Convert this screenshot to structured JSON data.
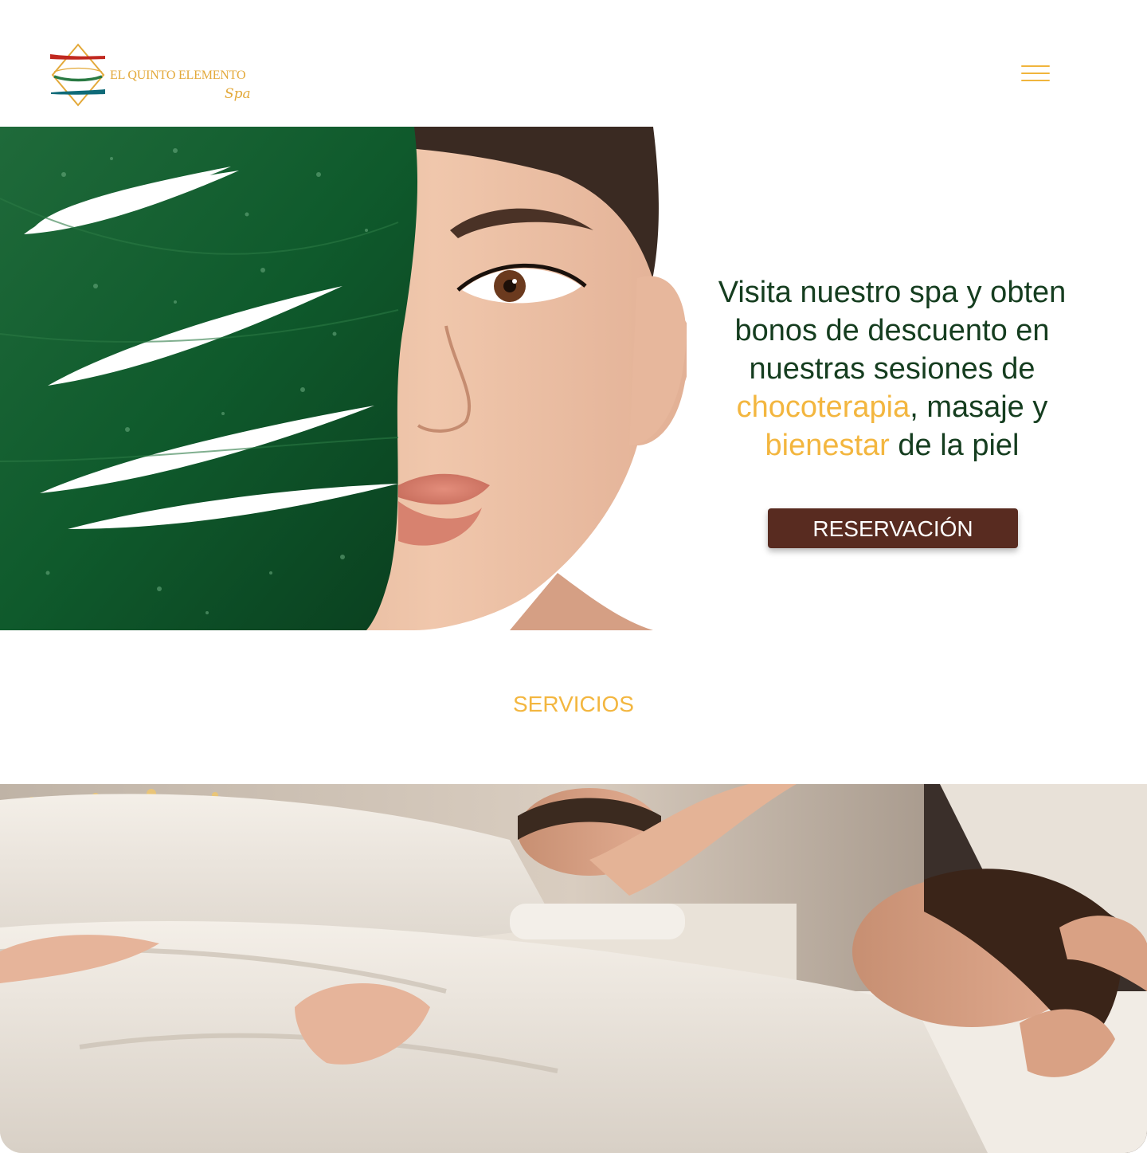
{
  "header": {
    "brand_name": "EL QUINTO ELEMENTO",
    "brand_sub": "Spa",
    "menu_icon": "hamburger-menu-icon"
  },
  "hero": {
    "line1": "Visita nuestro spa y obten",
    "line2": "bonos de descuento en",
    "line3": "nuestras sesiones de",
    "highlight1": "chocoterapia",
    "line4_rest": ", masaje y",
    "highlight2": "bienestar",
    "line5_rest": " de la piel",
    "cta_label": "RESERVACIÓN"
  },
  "services": {
    "title": "SERVICIOS"
  },
  "colors": {
    "accent_gold": "#f3b63f",
    "text_green": "#153d1f",
    "button_brown": "#582b20",
    "logo_red": "#c0281f",
    "logo_teal": "#0f6a78",
    "logo_green": "#2a7a43"
  }
}
